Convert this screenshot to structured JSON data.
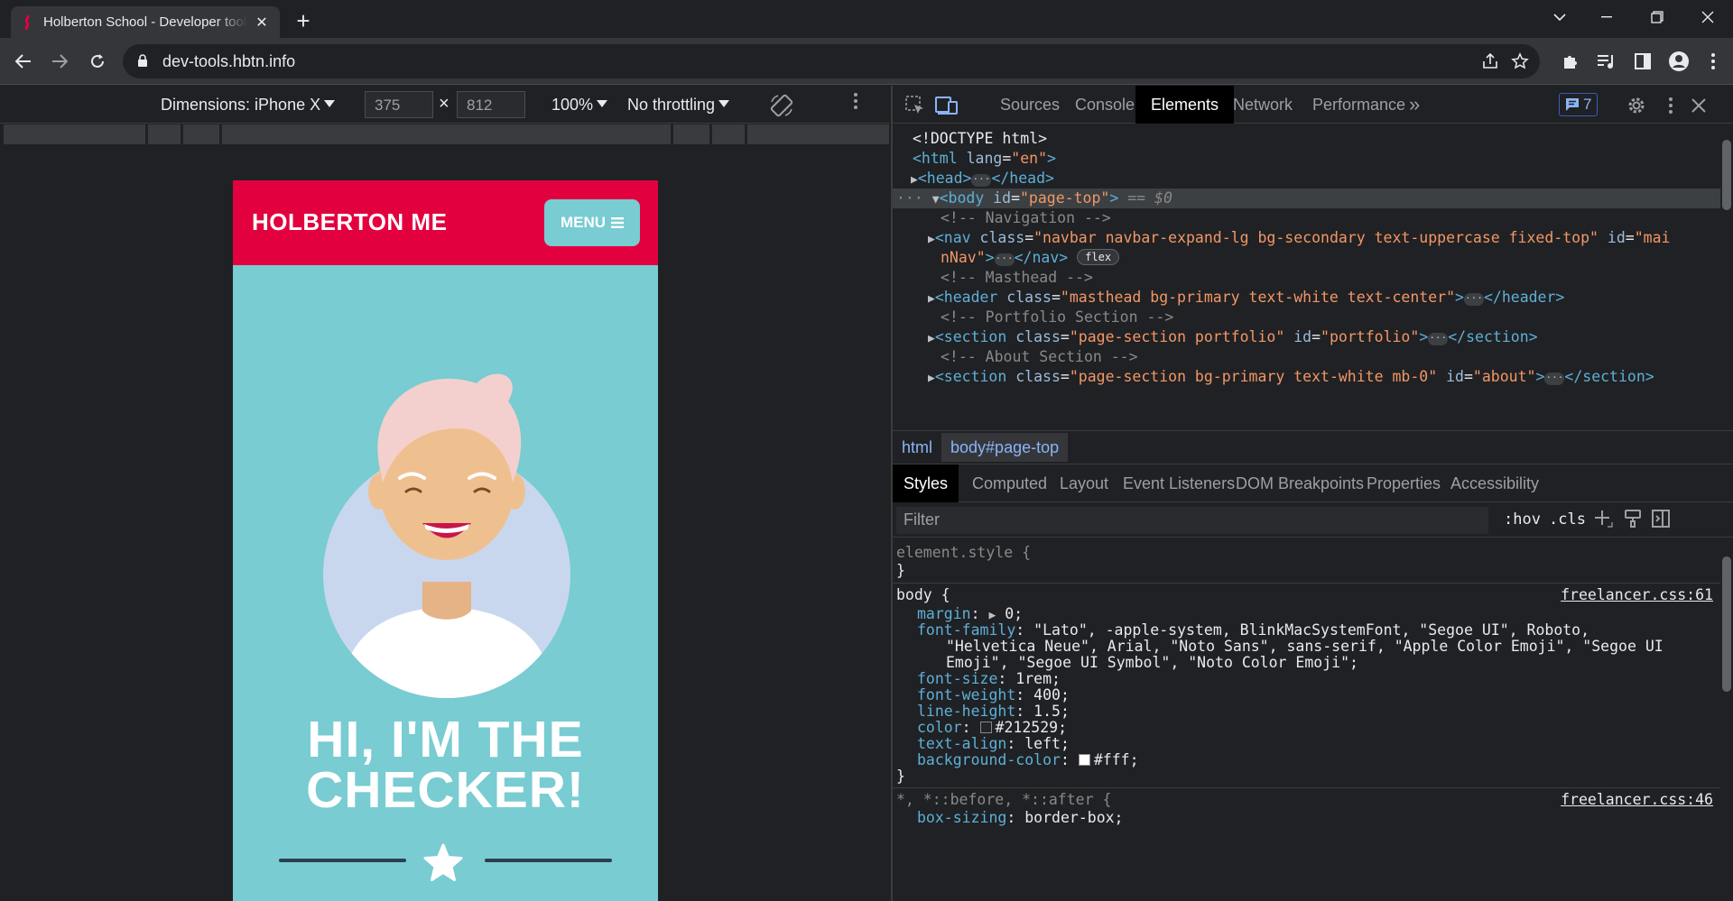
{
  "browser": {
    "tab_title": "Holberton School - Developer tools",
    "url": "dev-tools.hbtn.info"
  },
  "device_toolbar": {
    "dimensions_label": "Dimensions: iPhone X",
    "width": "375",
    "times": "×",
    "height": "812",
    "zoom": "100%",
    "throttling": "No throttling"
  },
  "page": {
    "brand": "HOLBERTON ME",
    "menu_label": "MENU",
    "headline_line1": "HI, I'M THE",
    "headline_line2": "CHECKER!",
    "colors": {
      "navbar": "#e3003f",
      "body": "#78ccd2",
      "dark": "#2c3e50"
    }
  },
  "devtools": {
    "tabs": [
      "Sources",
      "Console",
      "Elements",
      "Network",
      "Performance"
    ],
    "active_tab": "Elements",
    "more_tabs": "»",
    "issues_count": "7",
    "dom": {
      "doctype": "<!DOCTYPE html>",
      "html_open_tag": "<html",
      "html_attr": " lang",
      "html_attr_val": "\"en\"",
      "html_close": ">",
      "head_open": "<head>",
      "head_close": "</head>",
      "body_open": "<body",
      "body_attr": " id",
      "body_attr_val": "\"page-top\"",
      "body_gt": ">",
      "body_eq": " == ",
      "body_ref": "$0",
      "comment_nav": "<!-- Navigation -->",
      "nav_line1_tag": "<nav",
      "nav_line1_attr": " class",
      "nav_line1_val": "\"navbar navbar-expand-lg bg-secondary text-uppercase fixed-top\"",
      "nav_line1_attr2": " id",
      "nav_line1_val2a": "\"mai",
      "nav_line2_val2b": "nNav\"",
      "nav_line2_gt": ">",
      "nav_close": "</nav>",
      "flex_pill": "flex",
      "comment_masthead": "<!-- Masthead -->",
      "header_tag": "<header",
      "header_attr": " class",
      "header_val": "\"masthead bg-primary text-white text-center\"",
      "header_gt": ">",
      "header_close": "</header>",
      "comment_portfolio": "<!-- Portfolio Section -->",
      "section1_tag": "<section",
      "section1_attr": " class",
      "section1_val": "\"page-section portfolio\"",
      "section1_attr2": " id",
      "section1_val2": "\"portfolio\"",
      "section1_gt": ">",
      "section_close": "</section>",
      "comment_about": "<!-- About Section -->",
      "section2_tag": "<section",
      "section2_attr": " class",
      "section2_val": "\"page-section bg-primary text-white mb-0\"",
      "section2_attr2": " id",
      "section2_val2": "\"about\"",
      "section2_gt": ">"
    },
    "breadcrumbs": [
      "html",
      "body#page-top"
    ],
    "subtabs": [
      "Styles",
      "Computed",
      "Layout",
      "Event Listeners",
      "DOM Breakpoints",
      "Properties",
      "Accessibility"
    ],
    "active_subtab": "Styles",
    "filter_placeholder": "Filter",
    "hov": ":hov",
    "cls": ".cls",
    "styles": {
      "element_style": "element.style {",
      "close_brace": "}",
      "body_selector": "body {",
      "body_source": "freelancer.css:61",
      "margin_prop": "margin",
      "margin_val": "0;",
      "font_family_prop": "font-family",
      "font_family_val1": "\"Lato\", -apple-system, BlinkMacSystemFont, \"Segoe UI\", Roboto,",
      "font_family_val2": "\"Helvetica Neue\", Arial, \"Noto Sans\", sans-serif, \"Apple Color Emoji\", \"Segoe UI",
      "font_family_val3": "Emoji\", \"Segoe UI Symbol\", \"Noto Color Emoji\";",
      "font_size_prop": "font-size",
      "font_size_val": "1rem;",
      "font_weight_prop": "font-weight",
      "font_weight_val": "400;",
      "line_height_prop": "line-height",
      "line_height_val": "1.5;",
      "color_prop": "color",
      "color_val": "#212529;",
      "text_align_prop": "text-align",
      "text_align_val": "left;",
      "bg_prop": "background-color",
      "bg_val": "#fff;",
      "universal_selector": "*, *::before, *::after {",
      "universal_source": "freelancer.css:46",
      "box_sizing_prop": "box-sizing",
      "box_sizing_val": "border-box;"
    }
  }
}
